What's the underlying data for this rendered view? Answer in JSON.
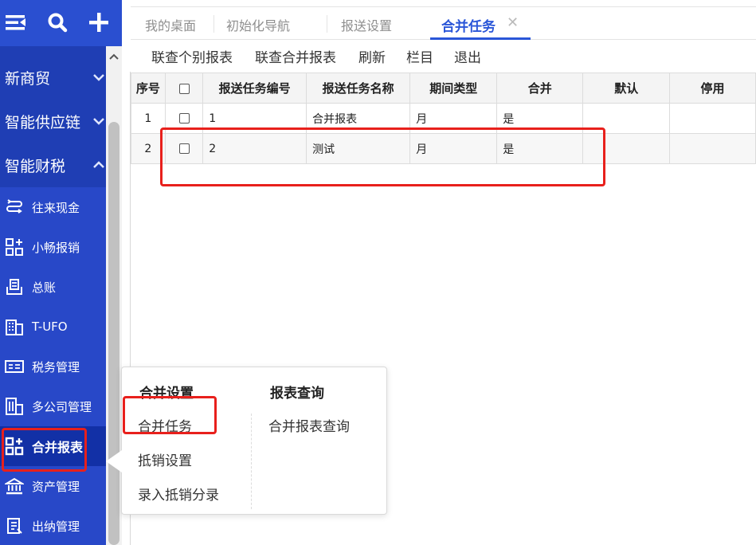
{
  "sidebar": {
    "groups": [
      {
        "label": "新商贸",
        "chevron": "down"
      },
      {
        "label": "智能供应链",
        "chevron": "down"
      },
      {
        "label": "智能财税",
        "chevron": "up"
      }
    ],
    "items": [
      {
        "label": "往来现金",
        "icon": "exchange-icon"
      },
      {
        "label": "小畅报销",
        "icon": "apps-icon"
      },
      {
        "label": "总账",
        "icon": "ledger-icon"
      },
      {
        "label": "T-UFO",
        "icon": "building-icon"
      },
      {
        "label": "税务管理",
        "icon": "invoice-icon"
      },
      {
        "label": "多公司管理",
        "icon": "company-icon"
      },
      {
        "label": "合并报表",
        "icon": "apps-icon",
        "active": true
      },
      {
        "label": "资产管理",
        "icon": "bank-icon"
      },
      {
        "label": "出纳管理",
        "icon": "cashier-icon"
      }
    ]
  },
  "tabs": [
    {
      "label": "我的桌面"
    },
    {
      "label": "初始化导航"
    },
    {
      "label": "报送设置"
    },
    {
      "label": "合并任务",
      "active": true
    }
  ],
  "tab_close_glyph": "✕",
  "toolbar": {
    "buttons": [
      "联查个别报表",
      "联查合并报表",
      "刷新",
      "栏目",
      "退出"
    ]
  },
  "table": {
    "headers": [
      "序号",
      "",
      "报送任务编号",
      "报送任务名称",
      "期间类型",
      "合并",
      "默认",
      "停用"
    ],
    "rows": [
      {
        "index": "1",
        "code": "1",
        "name": "合并报表",
        "period": "月",
        "merge": "是",
        "default": "",
        "disabled": ""
      },
      {
        "index": "2",
        "code": "2",
        "name": "测试",
        "period": "月",
        "merge": "是",
        "default": "",
        "disabled": ""
      }
    ]
  },
  "flyout": {
    "col1_title": "合并设置",
    "col1_items": [
      "合并任务",
      "抵销设置",
      "录入抵销分录"
    ],
    "col2_title": "报表查询",
    "col2_items": [
      "合并报表查询"
    ]
  },
  "colors": {
    "sidebar": "#1f3eb4",
    "accent": "#2a56d8",
    "highlight": "#e8201c"
  }
}
